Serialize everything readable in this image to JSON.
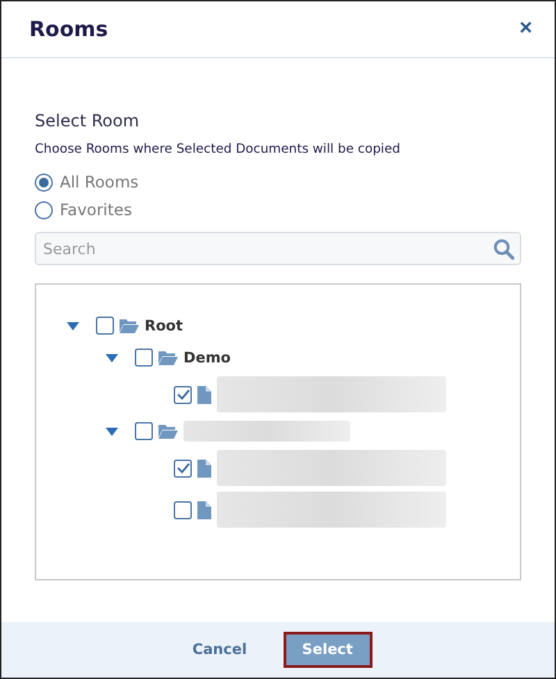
{
  "window": {
    "title": "Rooms",
    "close": "×"
  },
  "section_title": "Select Room",
  "description": "Choose Rooms where Selected Documents will be copied",
  "options": [
    {
      "label": "All Rooms",
      "selected": true
    },
    {
      "label": "Favorites",
      "selected": false
    }
  ],
  "search": {
    "placeholder": "Search"
  },
  "tree": [
    {
      "kind": "folder",
      "label": "Root",
      "redacted": false,
      "checked": false,
      "expanded": true,
      "children": [
        {
          "kind": "folder",
          "label": "Demo",
          "redacted": false,
          "checked": false,
          "expanded": true,
          "children": [
            {
              "kind": "file",
              "redacted": true,
              "checked": true
            }
          ]
        },
        {
          "kind": "folder",
          "redacted": true,
          "checked": false,
          "expanded": true,
          "children": [
            {
              "kind": "file",
              "redacted": true,
              "checked": true
            },
            {
              "kind": "file",
              "redacted": true,
              "checked": false
            }
          ]
        }
      ]
    }
  ],
  "buttons": [
    {
      "label": "Cancel",
      "kind": "link"
    },
    {
      "label": "Select",
      "kind": "primary"
    }
  ]
}
